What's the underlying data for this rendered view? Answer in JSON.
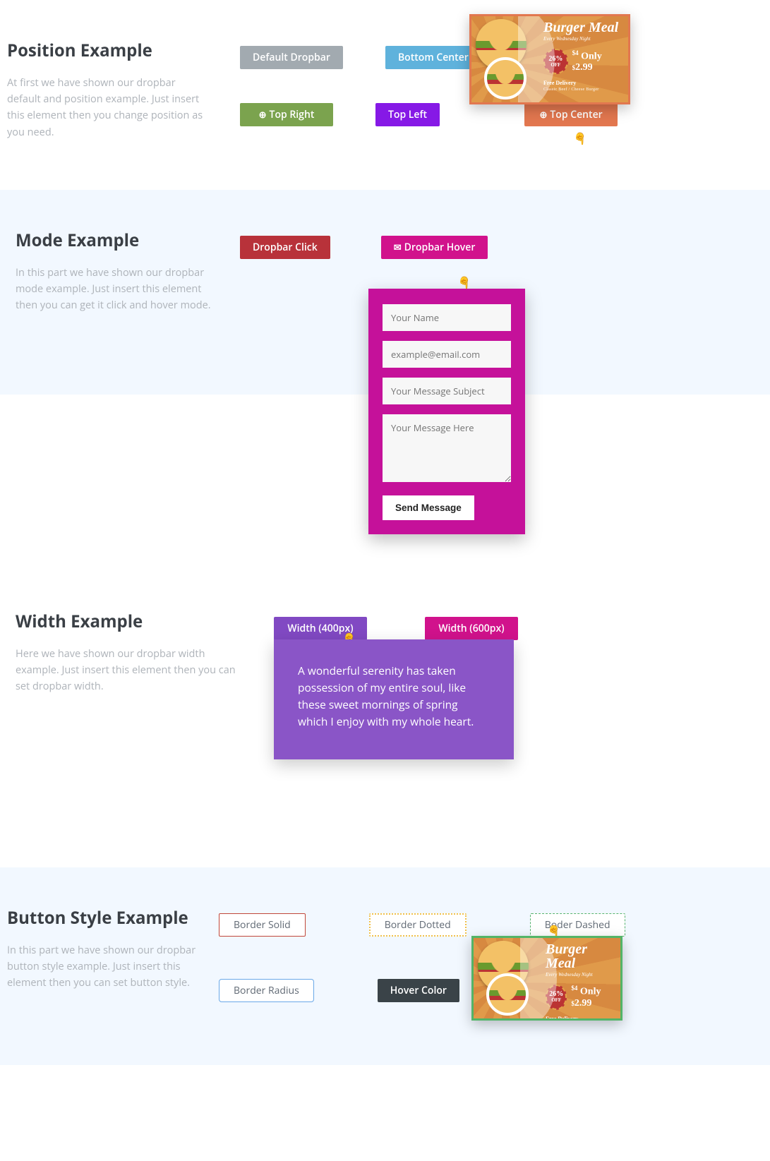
{
  "section1": {
    "title": "Position Example",
    "desc": "At first we have shown our dropbar default and position example. Just insert this element then you change position as you need.",
    "buttons": {
      "default": "Default Dropbar",
      "bottom_center": "Bottom Center",
      "top_right": "Top Right",
      "top_left": "Top Left",
      "top_center": "Top Center"
    }
  },
  "section2": {
    "title": "Mode Example",
    "desc": "In this part we have shown our dropbar mode example. Just insert this element then you can get it click and hover mode.",
    "buttons": {
      "click": "Dropbar Click",
      "hover": "Dropbar Hover"
    },
    "form": {
      "name_ph": "Your Name",
      "email_ph": "example@email.com",
      "subject_ph": "Your Message Subject",
      "message_ph": "Your Message Here",
      "send": "Send Message"
    }
  },
  "section3": {
    "title": "Width Example",
    "desc": "Here we have shown our dropbar width example. Just insert this element then you can set dropbar width.",
    "buttons": {
      "w400": "Width (400px)",
      "w600": "Width (600px)"
    },
    "panel_text": "A wonderful serenity has taken possession of my entire soul, like these sweet mornings of spring which I enjoy with my whole heart."
  },
  "section4": {
    "title": "Button Style Example",
    "desc": "In this part we have shown our dropbar button style example. Just insert this element then you can set button style.",
    "buttons": {
      "solid": "Border Solid",
      "dotted": "Border Dotted",
      "dashed": "Boder Dashed",
      "radius": "Border Radius",
      "hover": "Hover Color"
    }
  },
  "ad": {
    "title": "Burger Meal",
    "subtitle": "Every Wednesday Night",
    "badge_pct": "26%",
    "badge_off": "OFF",
    "price_pre": "$4",
    "price_only": "Only",
    "price_cur": "$",
    "price_val": "2.99",
    "free": "Free Delivery",
    "tiny": "Classic Beef / Cheese Burger"
  },
  "colors": {
    "gray": "#a2aab0",
    "blue": "#5fb2dc",
    "coral": "#e2774f",
    "green": "#7ba34e",
    "violet": "#8619e6",
    "crimson": "#b8323a",
    "magenta": "#d1128c",
    "purple": "#8149c3",
    "pink": "#d1128c",
    "dark": "#3a4348",
    "panel_purple": "#8a55c7",
    "form_bg": "#c5119a",
    "dashed_border": "#57b36f",
    "ad_green_border": "#53b467"
  }
}
